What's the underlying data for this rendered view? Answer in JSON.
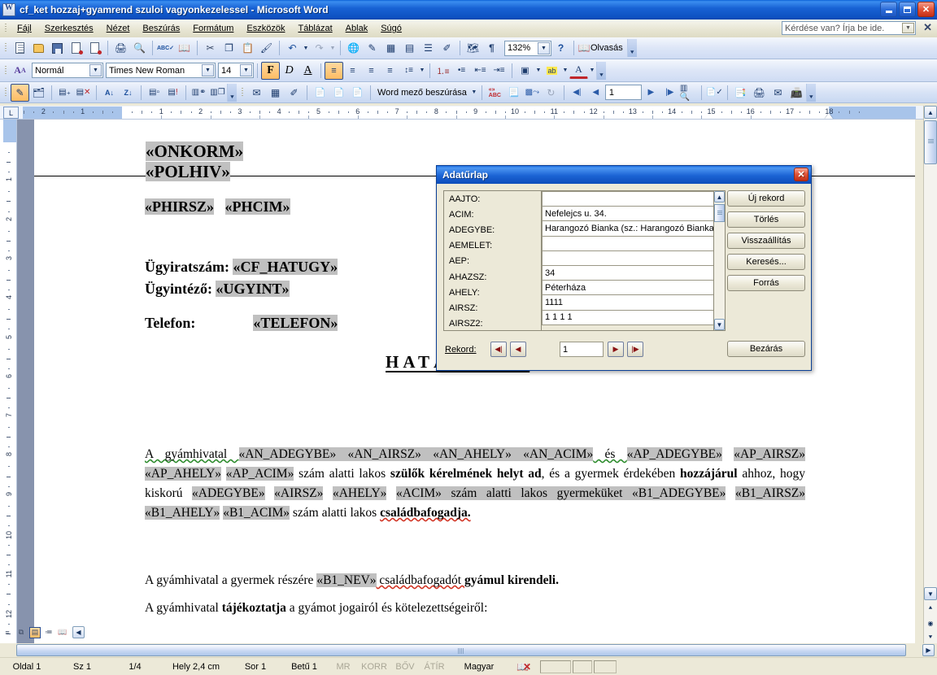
{
  "window": {
    "title": "cf_ket hozzaj+gyamrend szuloi vagyonkezelessel - Microsoft Word",
    "minimize": "_",
    "restore": "❐",
    "close": "✕"
  },
  "menu": {
    "items": [
      "Fájl",
      "Szerkesztés",
      "Nézet",
      "Beszúrás",
      "Formátum",
      "Eszközök",
      "Táblázat",
      "Ablak",
      "Súgó"
    ],
    "ask_placeholder": "Kérdése van? Írja be ide.",
    "ask_close": "✕"
  },
  "toolbars": {
    "standard": [
      {
        "name": "new-document-icon",
        "glyph": "🗋"
      },
      {
        "name": "open-icon",
        "glyph": "📂"
      },
      {
        "name": "save-icon",
        "glyph": "💾"
      },
      {
        "name": "permission-icon",
        "glyph": "🔒"
      },
      {
        "name": "mail-recipient-icon",
        "glyph": "✉"
      },
      {
        "name": "print-icon",
        "glyph": "🖨"
      },
      {
        "name": "print-preview-icon",
        "glyph": "🔍"
      },
      {
        "name": "spelling-icon",
        "glyph": "ABC"
      },
      {
        "name": "research-icon",
        "glyph": "📖"
      },
      {
        "name": "cut-icon",
        "glyph": "✂"
      },
      {
        "name": "copy-icon",
        "glyph": "❐"
      },
      {
        "name": "paste-icon",
        "glyph": "📋"
      },
      {
        "name": "format-painter-icon",
        "glyph": "🖌"
      },
      {
        "name": "undo-icon",
        "glyph": "↶"
      },
      {
        "name": "undo-dropdown-icon",
        "glyph": "▾"
      },
      {
        "name": "redo-icon",
        "glyph": "↷"
      },
      {
        "name": "redo-dropdown-icon",
        "glyph": "▾"
      },
      {
        "name": "hyperlink-icon",
        "glyph": "🌐"
      },
      {
        "name": "tables-borders-icon",
        "glyph": "⊞"
      },
      {
        "name": "insert-table-icon",
        "glyph": "▦"
      },
      {
        "name": "insert-excel-sheet-icon",
        "glyph": "▤"
      },
      {
        "name": "columns-icon",
        "glyph": "☰"
      },
      {
        "name": "drawing-icon",
        "glyph": "✎"
      },
      {
        "name": "document-map-icon",
        "glyph": "🗺"
      },
      {
        "name": "show-formatting-icon",
        "glyph": "¶"
      }
    ],
    "zoom_value": "132%",
    "help_icon": "?",
    "reading_label": "Olvasás",
    "formatting": {
      "styles_icon": "A",
      "style_value": "Normál",
      "font_value": "Times New Roman",
      "size_value": "14",
      "bold": "F",
      "italic": "D",
      "underline": "A",
      "align_left": "≡",
      "align_center": "≡",
      "align_right": "≡",
      "justify": "≡",
      "line_spacing": "↕",
      "numbering": "≣",
      "bullets": "≣",
      "decrease_indent": "≤",
      "increase_indent": "≥",
      "outside_border": "□",
      "highlight": "ab",
      "font_color": "A"
    },
    "mailmerge": {
      "insert_field_label": "Word mező beszúrása",
      "record_value": "1",
      "buttons": [
        {
          "name": "main-document-setup-icon",
          "glyph": "✎"
        },
        {
          "name": "open-data-source-icon",
          "glyph": "🗂"
        },
        {
          "name": "mailmerge-recipients-icon",
          "glyph": "☰"
        },
        {
          "name": "exclude-recipient-icon",
          "glyph": "✖"
        },
        {
          "name": "sort-ascending-icon",
          "glyph": "A↓"
        },
        {
          "name": "sort-descending-icon",
          "glyph": "Z↓"
        },
        {
          "name": "insert-address-block-icon",
          "glyph": "▤"
        },
        {
          "name": "insert-greeting-line-icon",
          "glyph": "!"
        },
        {
          "name": "match-fields-icon",
          "glyph": "⚭"
        },
        {
          "name": "propagate-labels-icon",
          "glyph": "⧉"
        },
        {
          "name": "envelopes-icon",
          "glyph": "✉"
        },
        {
          "name": "labels-icon",
          "glyph": "▦"
        },
        {
          "name": "mail-merge-wizard-icon",
          "glyph": "✎"
        },
        {
          "name": "insert-merge-field-icon",
          "glyph": "📄"
        },
        {
          "name": "insert-word-field-icon",
          "glyph": "📄"
        },
        {
          "name": "view-merged-data-icon",
          "glyph": "▤"
        },
        {
          "name": "highlight-merge-fields-icon",
          "glyph": "ABC"
        },
        {
          "name": "address-block-icon",
          "glyph": "📃"
        },
        {
          "name": "greeting-line-icon",
          "glyph": "⤵"
        },
        {
          "name": "update-fields-icon",
          "glyph": "↻"
        },
        {
          "name": "first-record-icon",
          "glyph": "⏮"
        },
        {
          "name": "previous-record-icon",
          "glyph": "◀"
        },
        {
          "name": "next-record-icon",
          "glyph": "▶"
        },
        {
          "name": "last-record-icon",
          "glyph": "⏭"
        },
        {
          "name": "find-entry-icon",
          "glyph": "🔎"
        },
        {
          "name": "check-errors-icon",
          "glyph": "✓"
        },
        {
          "name": "merge-to-new-document-icon",
          "glyph": "📑"
        },
        {
          "name": "merge-to-printer-icon",
          "glyph": "🖨"
        },
        {
          "name": "merge-to-email-icon",
          "glyph": "✉"
        },
        {
          "name": "merge-to-fax-icon",
          "glyph": "📠"
        }
      ]
    }
  },
  "ruler": {
    "horizontal_numbers": [
      "2",
      "1",
      "1",
      "2",
      "3",
      "4",
      "5",
      "6",
      "7",
      "8",
      "9",
      "10",
      "11",
      "12",
      "13",
      "14",
      "15",
      "17",
      "18"
    ],
    "vertical_numbers": [
      "1",
      "2",
      "3",
      "4",
      "5",
      "6",
      "7",
      "8",
      "9",
      "10",
      "11",
      "12"
    ]
  },
  "document": {
    "header_line1": "«ONKORM»",
    "header_line2": "«POLHIV»",
    "header_line3a": "«PHIRSZ»",
    "header_line3b": "«PHCIM»",
    "case_label": "Ügyiratszám:",
    "case_field": "«CF_HATUGY»",
    "officer_label": "Ügyintéző:",
    "officer_field": "«UGYINT»",
    "phone_label": "Telefon:",
    "phone_field": "«TELEFON»",
    "decision_heading": "HATÁROZAT",
    "p1": {
      "t1": "A   gyámhivatal   ",
      "f1": "«AN_ADEGYBE»",
      "t2": "  ",
      "f2": "«AN_AIRSZ»",
      "t3": "  ",
      "f3": "«AN_AHELY»",
      "t4": "  ",
      "f4": "«AN_ACIM»",
      "t5": "  és  ",
      "f5": "«AP_ADEGYBE»",
      "t6": "  ",
      "f6": "«AP_AIRSZ»",
      "t7": "  ",
      "f7": "«AP_AHELY»",
      "t8": "  ",
      "f8": "«AP_ACIM»",
      "t9": "  szám alatti lakos ",
      "b1": "szülők kérelmének helyt ad",
      "t10": ", és   a gyermek érdekében ",
      "b2": "hozzájárul",
      "t11": " ahhoz, hogy kiskorú ",
      "f9": "«ADEGYBE»",
      "t12": "   ",
      "f10": "«AIRSZ»",
      "t13": "   ",
      "f11": "«AHELY»",
      "t14": "   ",
      "f12": "«ACIM»",
      "t15": "   szám  alatti  lakos  gyermeküket ",
      "f13": "«B1_ADEGYBE»",
      "t16": "   ",
      "f14": "«B1_AIRSZ»",
      "t17": "   ",
      "f15": "«B1_AHELY»",
      "t18": "   ",
      "f16": "«B1_ACIM»",
      "t19": "       szám  alatti  lakos  ",
      "b3": "családbafogadja."
    },
    "p2": {
      "t1": "A gyámhivatal a gyermek részére ",
      "f1": "«B1_NEV»",
      "t2": " családbafogadót ",
      "b1": "gyámul kirendeli."
    },
    "p3": {
      "t1": "A gyámhivatal ",
      "b1": "tájékoztatja",
      "t2": " a gyámot jogairól és kötelezettségeiről:"
    }
  },
  "dialog": {
    "title": "Adatűrlap",
    "close": "✕",
    "fields": [
      {
        "label": "AAJTO:",
        "value": ""
      },
      {
        "label": "ACIM:",
        "value": "Nefelejcs u. 34."
      },
      {
        "label": "ADEGYBE:",
        "value": "Harangozó Bianka (sz.: Harangozó Bianka"
      },
      {
        "label": "AEMELET:",
        "value": ""
      },
      {
        "label": "AEP:",
        "value": ""
      },
      {
        "label": "AHAZSZ:",
        "value": "34"
      },
      {
        "label": "AHELY:",
        "value": "Péterháza"
      },
      {
        "label": "AIRSZ:",
        "value": "1111"
      },
      {
        "label": "AIRSZ2:",
        "value": "1 1 1 1"
      }
    ],
    "buttons": [
      {
        "name": "new-record-button",
        "label": "Új rekord"
      },
      {
        "name": "delete-button",
        "label": "Törlés"
      },
      {
        "name": "restore-button",
        "label": "Visszaállítás"
      },
      {
        "name": "find-button",
        "label": "Keresés..."
      },
      {
        "name": "source-button",
        "label": "Forrás"
      }
    ],
    "close_button": "Bezárás",
    "record_label": "Rekord:",
    "record_value": "1",
    "nav": {
      "first": "◀|",
      "prev": "◀",
      "next": "▶",
      "last": "|▶"
    }
  },
  "statusbar": {
    "page": "Oldal  1",
    "section": "Sz  1",
    "pages": "1/4",
    "position": "Hely  2,4 cm",
    "line": "Sor  1",
    "column": "Betű  1",
    "rec": "MR",
    "trk": "KORR",
    "ext": "BŐV",
    "ovr": "ÁTÍR",
    "language": "Magyar",
    "spell_icon": "spelling-status-icon"
  },
  "view_buttons": [
    {
      "name": "normal-view-button",
      "glyph": "≡",
      "active": false
    },
    {
      "name": "web-layout-view-button",
      "glyph": "⧉",
      "active": false
    },
    {
      "name": "print-layout-view-button",
      "glyph": "▤",
      "active": true
    },
    {
      "name": "outline-view-button",
      "glyph": "≣",
      "active": false
    },
    {
      "name": "reading-layout-view-button",
      "glyph": "📖",
      "active": false
    }
  ],
  "colors": {
    "titlebar_blue": "#1862d4",
    "toolbar_bg": "#dde6f7",
    "status_bg": "#ece9d8",
    "field_highlight": "#c0c0c0",
    "dialog_title": "#1b63d4"
  }
}
